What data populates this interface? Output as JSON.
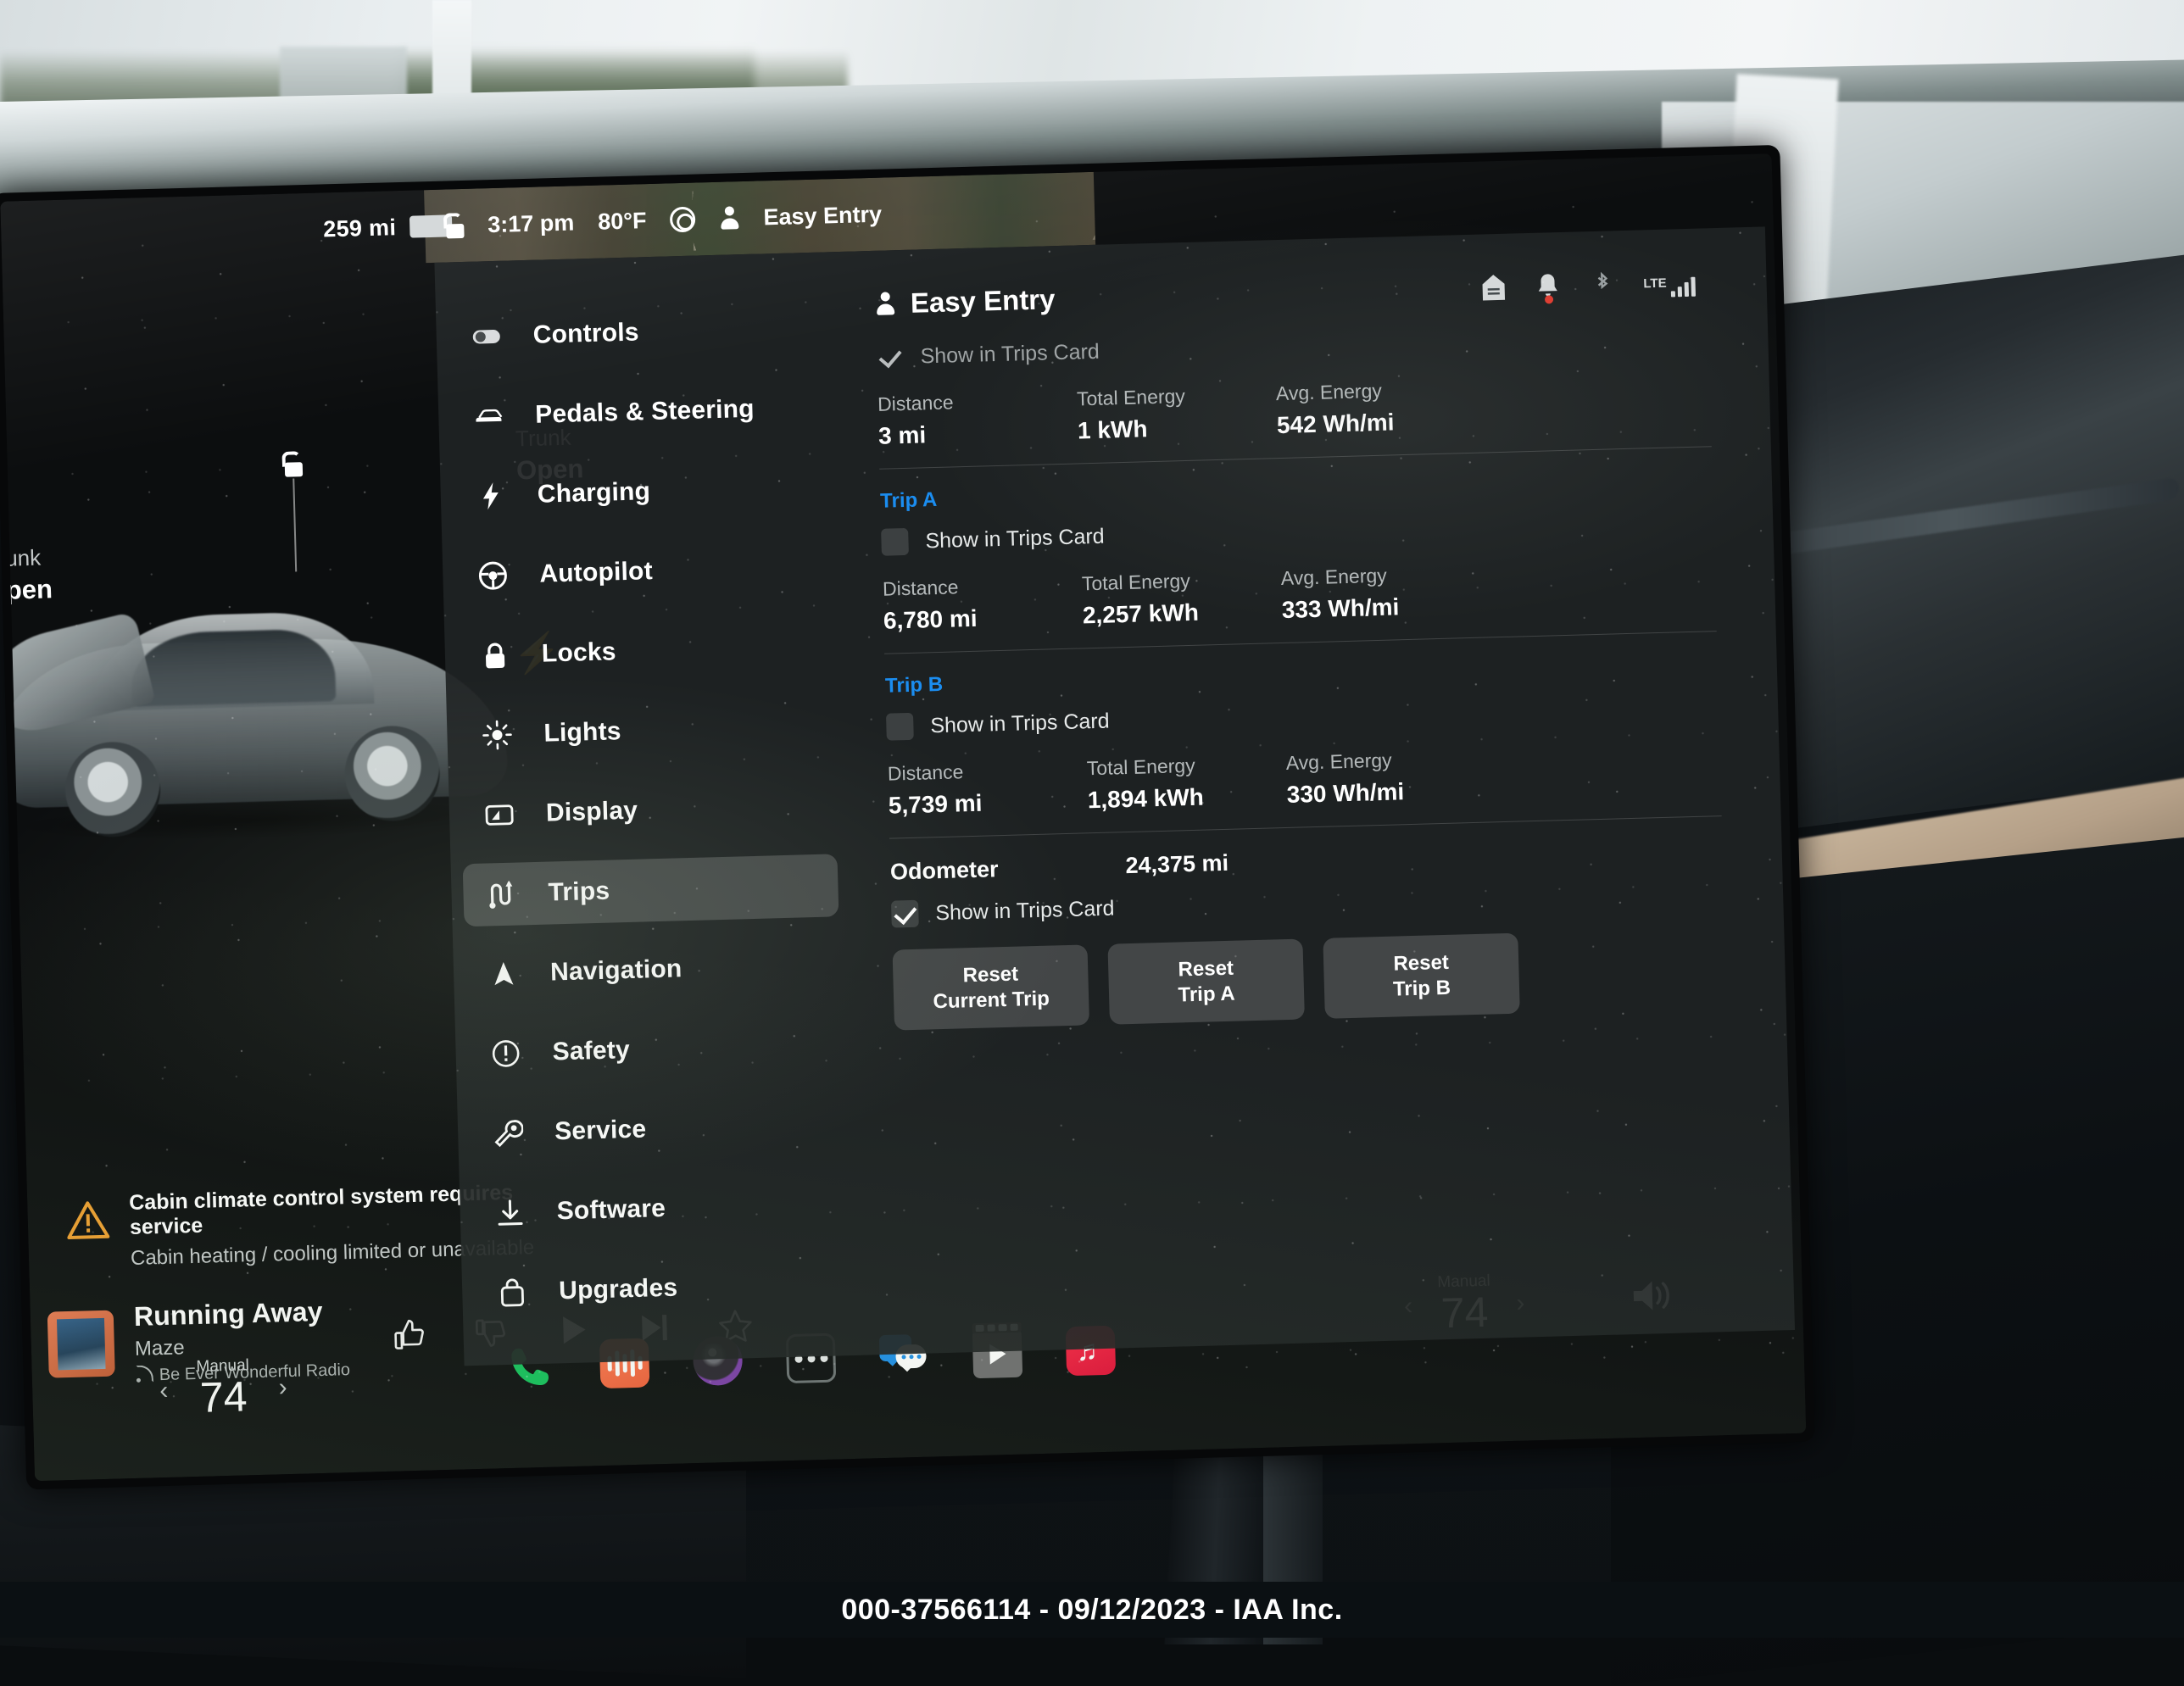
{
  "status_bar": {
    "range": "259 mi",
    "battery_icon": "battery-icon",
    "lock_icon": "lock-open-icon",
    "time": "3:17 pm",
    "temperature": "80°F",
    "seat_icon": "circles-icon",
    "profile_icon": "person-icon",
    "profile_name": "Easy Entry"
  },
  "vehicle": {
    "trunk_label": "Trunk",
    "trunk_state": "Open",
    "frunk_label": "Frunk",
    "frunk_state": "Open",
    "lock_marker_icon": "lock-open-icon",
    "charge_port_icon": "bolt-icon"
  },
  "warning": {
    "icon": "warning-triangle-icon",
    "title": "Cabin climate control system requires service",
    "subtitle": "Cabin heating / cooling limited or unavailable"
  },
  "media": {
    "album_art": "album-art",
    "title": "Running Away",
    "artist": "Maze",
    "station": "Be Ever Wonderful Radio",
    "station_icon": "radio-waves-icon",
    "controls": [
      {
        "name": "thumbs-up-icon"
      },
      {
        "name": "thumbs-down-icon"
      },
      {
        "name": "play-icon"
      },
      {
        "name": "skip-next-icon"
      },
      {
        "name": "favorite-star-icon"
      }
    ]
  },
  "climate_left": {
    "mode": "Manual",
    "temperature": "74",
    "prev_icon": "chevron-left-icon",
    "next_icon": "chevron-right-icon"
  },
  "climate_right": {
    "mode": "Manual",
    "temperature": "74",
    "prev_icon": "chevron-left-icon",
    "next_icon": "chevron-right-icon"
  },
  "volume": {
    "icon": "volume-icon"
  },
  "dock": [
    {
      "name": "phone-icon",
      "label": "Phone"
    },
    {
      "name": "audio-icon",
      "label": "Audio"
    },
    {
      "name": "camera-icon",
      "label": "Camera"
    },
    {
      "name": "more-icon",
      "label": "More"
    },
    {
      "name": "messages-icon",
      "label": "Messages"
    },
    {
      "name": "theater-icon",
      "label": "Theater"
    },
    {
      "name": "music-icon",
      "label": "Music"
    }
  ],
  "settings_menu": [
    {
      "label": "Controls",
      "icon": "toggle-icon",
      "active": false
    },
    {
      "label": "Pedals & Steering",
      "icon": "car-icon",
      "active": false
    },
    {
      "label": "Charging",
      "icon": "bolt-icon",
      "active": false
    },
    {
      "label": "Autopilot",
      "icon": "steering-wheel-icon",
      "active": false
    },
    {
      "label": "Locks",
      "icon": "lock-icon",
      "active": false
    },
    {
      "label": "Lights",
      "icon": "light-icon",
      "active": false
    },
    {
      "label": "Display",
      "icon": "display-icon",
      "active": false
    },
    {
      "label": "Trips",
      "icon": "trips-icon",
      "active": true
    },
    {
      "label": "Navigation",
      "icon": "navigation-arrow-icon",
      "active": false
    },
    {
      "label": "Safety",
      "icon": "exclamation-circle-icon",
      "active": false
    },
    {
      "label": "Service",
      "icon": "wrench-icon",
      "active": false
    },
    {
      "label": "Software",
      "icon": "download-icon",
      "active": false
    },
    {
      "label": "Upgrades",
      "icon": "bag-icon",
      "active": false
    }
  ],
  "detail": {
    "profile_icon": "person-icon",
    "profile_name": "Easy Entry",
    "tray_icons": [
      {
        "name": "home-icon"
      },
      {
        "name": "bell-icon"
      },
      {
        "name": "bluetooth-icon"
      },
      {
        "name": "lte-signal-icon",
        "label": "LTE"
      }
    ],
    "stat_headers": {
      "distance": "Distance",
      "total_energy": "Total Energy",
      "avg_energy": "Avg. Energy"
    },
    "show_in_trips_card": "Show in Trips Card",
    "current_trip": {
      "checked": true,
      "dimmed": true,
      "distance": "3 mi",
      "total_energy": "1 kWh",
      "avg_energy": "542 Wh/mi"
    },
    "trip_a": {
      "label": "Trip A",
      "checked": false,
      "distance": "6,780 mi",
      "total_energy": "2,257 kWh",
      "avg_energy": "333 Wh/mi"
    },
    "trip_b": {
      "label": "Trip B",
      "checked": false,
      "distance": "5,739 mi",
      "total_energy": "1,894 kWh",
      "avg_energy": "330 Wh/mi"
    },
    "odometer": {
      "label": "Odometer",
      "value": "24,375 mi",
      "checked": true
    },
    "buttons": {
      "reset_current": "Reset\nCurrent Trip",
      "reset_a": "Reset\nTrip A",
      "reset_b": "Reset\nTrip B"
    }
  },
  "watermark": {
    "text": "000-37566114 - 09/12/2023 - IAA Inc."
  },
  "colors": {
    "accent_blue": "#1b8df0",
    "warning_amber": "#f0a030",
    "panel_bg": "#1f2224"
  }
}
